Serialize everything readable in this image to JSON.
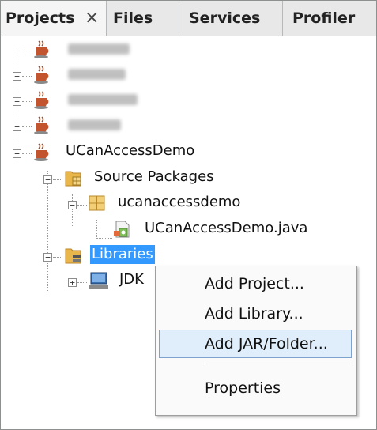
{
  "tabs": [
    {
      "label": "Projects",
      "close": "×",
      "active": true
    },
    {
      "label": "Files"
    },
    {
      "label": "Services"
    },
    {
      "label": "Profiler"
    }
  ],
  "tree": {
    "demo_project": "UCanAccessDemo",
    "source_packages": "Source Packages",
    "package": "ucanaccessdemo",
    "java_file": "UCanAccessDemo.java",
    "libraries": "Libraries",
    "jdk": "JDK"
  },
  "context_menu": {
    "items": [
      "Add Project...",
      "Add Library...",
      "Add JAR/Folder...",
      "Properties"
    ],
    "highlighted": "Add JAR/Folder..."
  },
  "colors": {
    "selection": "#3399ff",
    "menu_hover": "#e0edfb",
    "tab_bar": "#e8e8e9"
  },
  "icons": [
    "coffee-cup-project-icon",
    "folder-package-icon",
    "package-icon",
    "java-class-icon",
    "library-folder-icon",
    "computer-jdk-icon"
  ]
}
